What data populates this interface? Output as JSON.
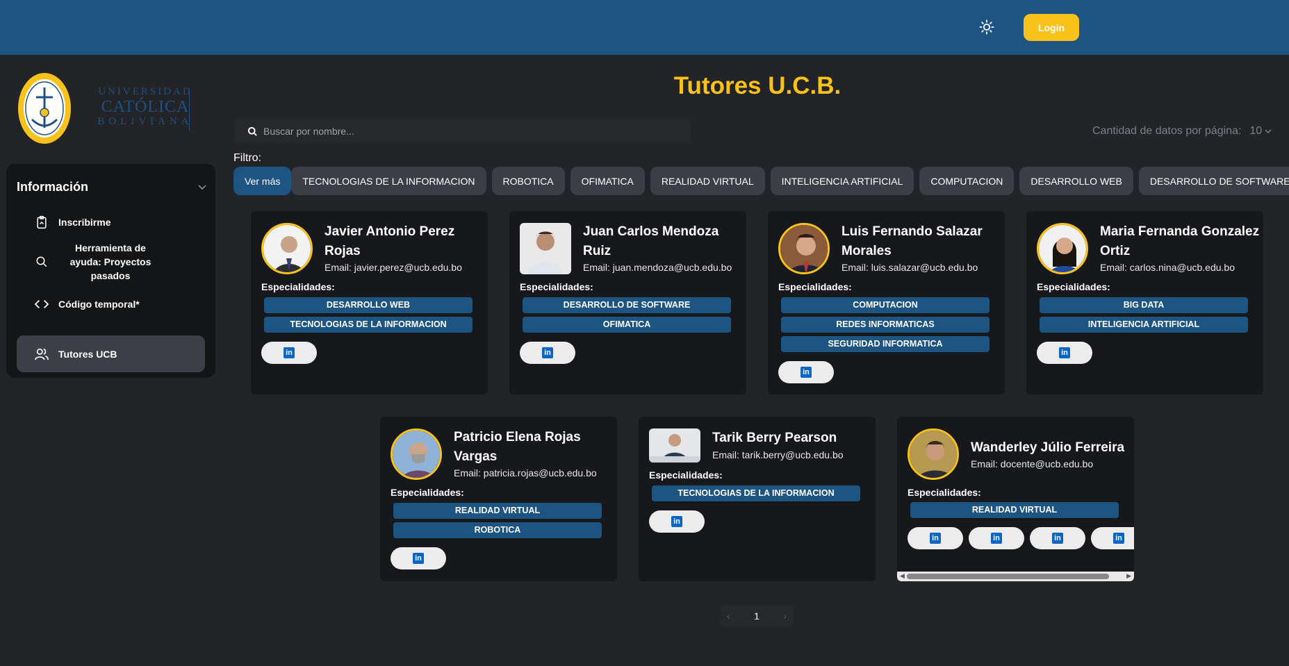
{
  "header": {
    "login_label": "Login",
    "theme_icon": "sun-icon"
  },
  "logo": {
    "lines": [
      "UNIVERSIDAD",
      "CATÓLICA",
      "BOLIVIANA"
    ],
    "seal_text": "UNIVERSIDAD CATÓLICA BOLIVIANA SAN PABLO",
    "seal_year": "MCMLXVI"
  },
  "sidebar": {
    "title": "Información",
    "items": [
      {
        "label": "Inscribirme",
        "icon": "clipboard-icon"
      },
      {
        "label": "Herramienta de ayuda: Proyectos pasados",
        "icon": "search-icon"
      },
      {
        "label": "Código temporal*",
        "icon": "code-icon"
      },
      {
        "label": "Tutores UCB",
        "icon": "users-icon",
        "active": true
      }
    ]
  },
  "main": {
    "title": "Tutores U.C.B.",
    "search_placeholder": "Buscar por nombre...",
    "per_page_label": "Cantidad de datos por página:",
    "per_page_value": "10",
    "filter_label": "Filtro:",
    "filters": [
      "Ver más",
      "TECNOLOGIAS DE LA INFORMACION",
      "ROBOTICA",
      "OFIMATICA",
      "REALIDAD VIRTUAL",
      "INTELIGENCIA ARTIFICIAL",
      "COMPUTACION",
      "DESARROLLO WEB",
      "DESARROLLO DE SOFTWARE"
    ],
    "specialties_label": "Especialidades:",
    "tutors": [
      {
        "name": "Javier Antonio Perez Rojas",
        "email": "Email: javier.perez@ucb.edu.bo",
        "specialties": [
          "DESARROLLO WEB",
          "TECNOLOGIAS DE LA INFORMACION"
        ],
        "links": 1
      },
      {
        "name": "Juan Carlos Mendoza Ruiz",
        "email": "Email: juan.mendoza@ucb.edu.bo",
        "specialties": [
          "DESARROLLO DE SOFTWARE",
          "OFIMATICA"
        ],
        "links": 1
      },
      {
        "name": "Luis Fernando Salazar Morales",
        "email": "Email: luis.salazar@ucb.edu.bo",
        "specialties": [
          "COMPUTACION",
          "REDES INFORMATICAS",
          "SEGURIDAD INFORMATICA"
        ],
        "links": 1
      },
      {
        "name": "Maria Fernanda Gonzalez Ortiz",
        "email": "Email: carlos.nina@ucb.edu.bo",
        "specialties": [
          "BIG DATA",
          "INTELIGENCIA ARTIFICIAL"
        ],
        "links": 1
      },
      {
        "name": "Patricio Elena Rojas Vargas",
        "email": "Email: patricia.rojas@ucb.edu.bo",
        "specialties": [
          "REALIDAD VIRTUAL",
          "ROBOTICA"
        ],
        "links": 1
      },
      {
        "name": "Tarik Berry Pearson",
        "email": "Email: tarik.berry@ucb.edu.bo",
        "specialties": [
          "TECNOLOGIAS DE LA INFORMACION"
        ],
        "links": 1
      },
      {
        "name": "Wanderley Júlio Ferreira",
        "email": "Email: docente@ucb.edu.bo",
        "specialties": [
          "REALIDAD VIRTUAL"
        ],
        "links": 4
      }
    ],
    "pagination": {
      "current": "1",
      "prev_icon": "chevron-left-icon",
      "next_icon": "chevron-right-icon"
    }
  },
  "colors": {
    "header": "#1d5482",
    "accent": "#f8c21a",
    "card": "#17181b",
    "background": "#222428",
    "tag": "#1d5482"
  }
}
